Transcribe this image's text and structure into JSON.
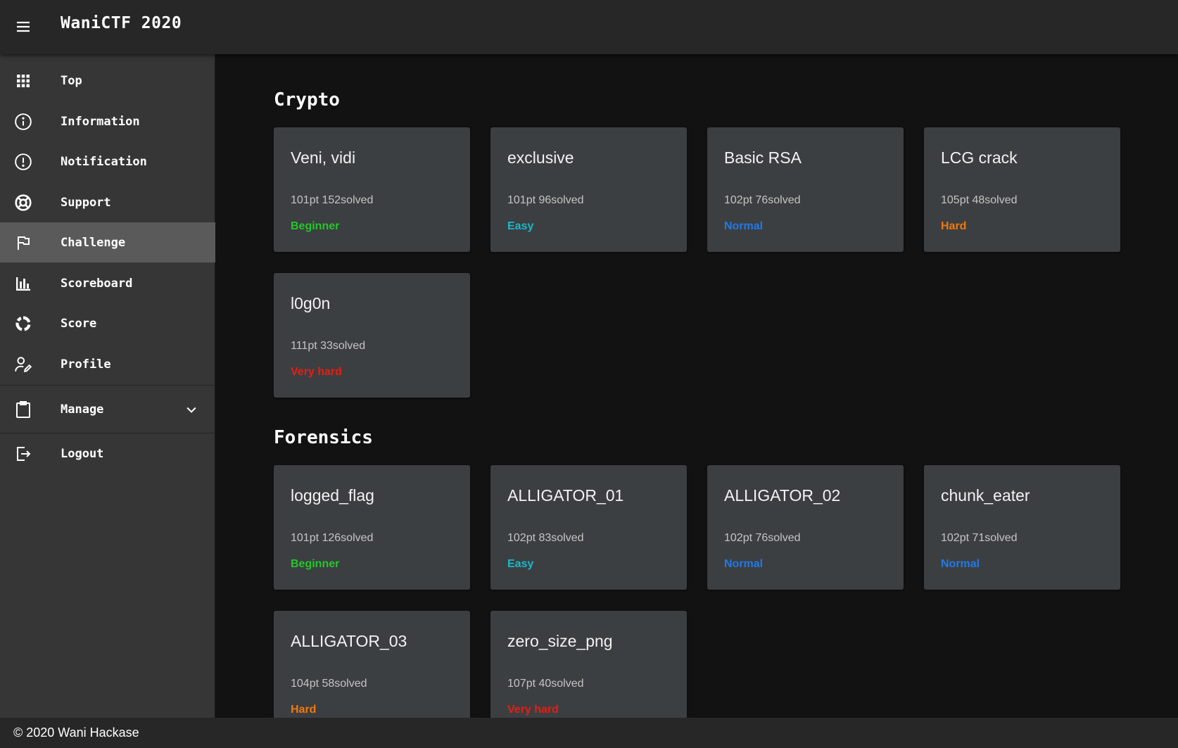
{
  "app": {
    "title": "WaniCTF 2020"
  },
  "icons": {
    "menu": "menu-icon",
    "chevron": "chevron-down-icon"
  },
  "sidebar": {
    "items": [
      {
        "id": "top",
        "label": "Top",
        "icon": "grid-icon",
        "active": false
      },
      {
        "id": "information",
        "label": "Information",
        "icon": "info-icon",
        "active": false
      },
      {
        "id": "notification",
        "label": "Notification",
        "icon": "alert-circle-icon",
        "active": false
      },
      {
        "id": "support",
        "label": "Support",
        "icon": "lifebuoy-icon",
        "active": false
      },
      {
        "id": "challenge",
        "label": "Challenge",
        "icon": "flag-icon",
        "active": true
      },
      {
        "id": "scoreboard",
        "label": "Scoreboard",
        "icon": "bar-chart-icon",
        "active": false
      },
      {
        "id": "score",
        "label": "Score",
        "icon": "donut-chart-icon",
        "active": false
      },
      {
        "id": "profile",
        "label": "Profile",
        "icon": "user-edit-icon",
        "active": false
      },
      {
        "id": "manage",
        "label": "Manage",
        "icon": "clipboard-icon",
        "active": false
      },
      {
        "id": "logout",
        "label": "Logout",
        "icon": "logout-icon",
        "active": false
      }
    ]
  },
  "colors": {
    "Beginner": "#25c52a",
    "Easy": "#1ab8c9",
    "Normal": "#1f7ae8",
    "Hard": "#f0780f",
    "Very hard": "#e81c14"
  },
  "sections": [
    {
      "title": "Crypto",
      "challenges": [
        {
          "name": "Veni, vidi",
          "stats": "101pt 152solved",
          "level": "Beginner"
        },
        {
          "name": "exclusive",
          "stats": "101pt 96solved",
          "level": "Easy"
        },
        {
          "name": "Basic RSA",
          "stats": "102pt 76solved",
          "level": "Normal"
        },
        {
          "name": "LCG crack",
          "stats": "105pt 48solved",
          "level": "Hard"
        },
        {
          "name": "l0g0n",
          "stats": "111pt 33solved",
          "level": "Very hard"
        }
      ]
    },
    {
      "title": "Forensics",
      "challenges": [
        {
          "name": "logged_flag",
          "stats": "101pt 126solved",
          "level": "Beginner"
        },
        {
          "name": "ALLIGATOR_01",
          "stats": "102pt 83solved",
          "level": "Easy"
        },
        {
          "name": "ALLIGATOR_02",
          "stats": "102pt 76solved",
          "level": "Normal"
        },
        {
          "name": "chunk_eater",
          "stats": "102pt 71solved",
          "level": "Normal"
        },
        {
          "name": "ALLIGATOR_03",
          "stats": "104pt 58solved",
          "level": "Hard"
        },
        {
          "name": "zero_size_png",
          "stats": "107pt 40solved",
          "level": "Very hard"
        }
      ]
    }
  ],
  "footer": {
    "text": "© 2020 Wani Hackase"
  }
}
